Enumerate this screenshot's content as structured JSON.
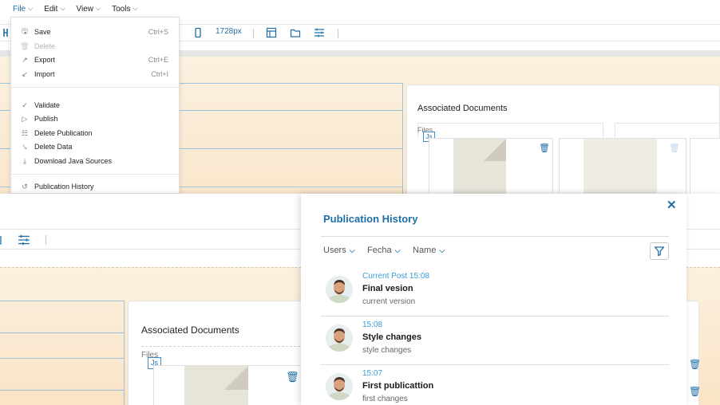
{
  "menubar": {
    "items": [
      {
        "label": "File"
      },
      {
        "label": "Edit"
      },
      {
        "label": "View"
      },
      {
        "label": "Tools"
      }
    ]
  },
  "toolbar": {
    "width_value": "1728px"
  },
  "file_menu": {
    "items": [
      {
        "label": "Save",
        "shortcut": "Ctrl+S",
        "icon": "save-icon",
        "disabled": false
      },
      {
        "label": "Delete",
        "shortcut": "",
        "icon": "trash-icon",
        "disabled": true
      },
      {
        "label": "Export",
        "shortcut": "Ctrl+E",
        "icon": "export-icon",
        "disabled": false
      },
      {
        "label": "Import",
        "shortcut": "Ctrl+I",
        "icon": "import-icon",
        "disabled": false
      },
      {
        "label": "Validate",
        "shortcut": "",
        "icon": "check-icon",
        "disabled": false
      },
      {
        "label": "Publish",
        "shortcut": "",
        "icon": "play-icon",
        "disabled": false
      },
      {
        "label": "Delete Publication",
        "shortcut": "",
        "icon": "document-delete-icon",
        "disabled": false
      },
      {
        "label": "Delete Data",
        "shortcut": "",
        "icon": "broom-icon",
        "disabled": false
      },
      {
        "label": "Download Java Sources",
        "shortcut": "",
        "icon": "download-icon",
        "disabled": false
      },
      {
        "label": "Publication History",
        "shortcut": "",
        "icon": "history-icon",
        "disabled": false
      }
    ]
  },
  "documents": {
    "title": "Associated Documents",
    "files_label": "Files",
    "badge": "Js"
  },
  "history_panel": {
    "title": "Publication History",
    "close_icon": "close-icon",
    "filters": [
      {
        "label": "Users"
      },
      {
        "label": "Fecha"
      },
      {
        "label": "Name"
      }
    ],
    "filter_button_icon": "filter-icon",
    "entries": [
      {
        "time": "Current Post 15:08",
        "name": "Final vesion",
        "description": "current version"
      },
      {
        "time": "15:08",
        "name": "Style changes",
        "description": "style changes"
      },
      {
        "time": "15:07",
        "name": "First publicattion",
        "description": "first changes"
      }
    ]
  },
  "colors": {
    "accent": "#1f6fa6",
    "time_text": "#3a9bd5",
    "canvas_bg": "#fbeedb"
  }
}
